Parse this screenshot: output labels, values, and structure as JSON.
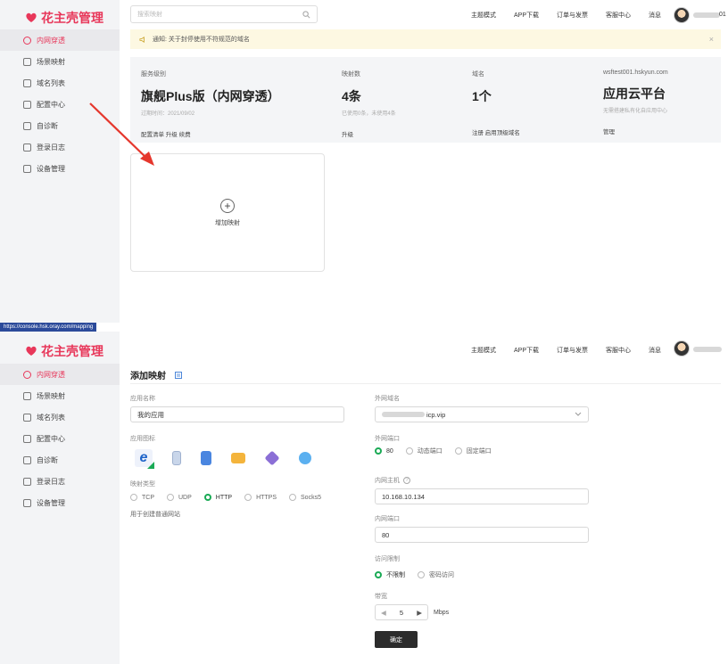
{
  "brand": {
    "name": "花主壳管理",
    "color": "#e8375a"
  },
  "top1": {
    "search_placeholder": "搜索映射",
    "nav": [
      "主题模式",
      "APP下载",
      "订单与发票",
      "客服中心",
      "消息"
    ],
    "user_suffix": "01"
  },
  "sidebar": {
    "items": [
      {
        "label": "内网穿透",
        "icon": "globe-icon"
      },
      {
        "label": "场景映射",
        "icon": "nodes-icon"
      },
      {
        "label": "域名列表",
        "icon": "list-icon"
      },
      {
        "label": "配置中心",
        "icon": "grid-icon"
      },
      {
        "label": "自诊断",
        "icon": "diagnose-icon"
      },
      {
        "label": "登录日志",
        "icon": "log-icon"
      },
      {
        "label": "设备管理",
        "icon": "device-icon"
      }
    ]
  },
  "notice": {
    "text": "通知: 关于封停使用不符规范的域名",
    "close": "×"
  },
  "stats": [
    {
      "label": "服务级别",
      "value": "旗舰Plus版（内网穿透）",
      "sub": "过期时间：2021/09/02",
      "links": "配置清单  升级  续费"
    },
    {
      "label": "映射数",
      "value": "4条",
      "sub": "已使用0条，未使用4条",
      "links": "升级"
    },
    {
      "label": "域名",
      "value": "1个",
      "sub": "",
      "links": "注册  启用顶级域名"
    },
    {
      "label": "wsftest001.hskyun.com",
      "value": "应用云平台",
      "sub": "无需搭建私有化自应用中心",
      "links": "管理"
    }
  ],
  "add_card": {
    "label": "增加映射"
  },
  "url_status": "https://console.hsk.oray.com/mapping",
  "form": {
    "title": "添加映射",
    "app_name_label": "应用名称",
    "app_name_value": "我的应用",
    "app_icon_label": "应用图标",
    "protocol_label": "映射类型",
    "protocols": [
      "TCP",
      "UDP",
      "HTTP",
      "HTTPS",
      "Socks5"
    ],
    "protocol_selected": "HTTP",
    "protocol_hint": "用于创建普通网站",
    "ext_domain_label": "外网域名",
    "ext_domain_value": "icp.vip",
    "ext_port_label": "外网端口",
    "ext_ports": [
      "80",
      "动态端口",
      "固定端口"
    ],
    "ext_port_selected": "80",
    "int_host_label": "内网主机",
    "int_host_value": "10.168.10.134",
    "int_port_label": "内网端口",
    "int_port_value": "80",
    "access_label": "访问限制",
    "access_options": [
      "不限制",
      "密码访问"
    ],
    "access_selected": "不限制",
    "bandwidth_label": "带宽",
    "bandwidth_value": "5",
    "bandwidth_unit": "Mbps",
    "submit": "确定"
  },
  "colors": {
    "accent": "#e8375a",
    "radio_on": "#1aaa55",
    "arrow": "#e5372d"
  }
}
